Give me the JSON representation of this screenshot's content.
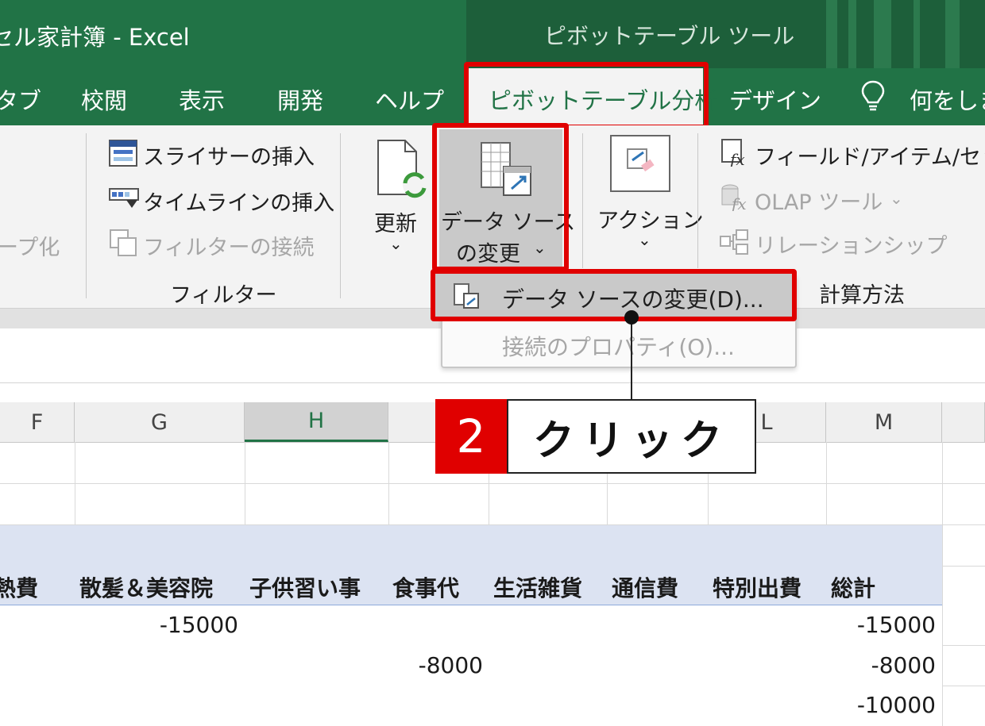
{
  "window": {
    "title": "セル家計簿 - Excel",
    "context_tools": "ピボットテーブル ツール"
  },
  "tabs": {
    "items": [
      "タブ",
      "校閲",
      "表示",
      "開発",
      "ヘルプ"
    ],
    "active": "ピボットテーブル分析",
    "design": "デザイン",
    "tell_me": "何をしま"
  },
  "ribbon": {
    "group_label_partial": "ープ化",
    "slicer_insert": "スライサーの挿入",
    "timeline_insert": "タイムラインの挿入",
    "filter_connect": "フィルターの接続",
    "filter_group": "フィルター",
    "refresh": "更新",
    "change_source_l1": "データ ソース",
    "change_source_l2": "の変更",
    "action": "アクション",
    "field_items": "フィールド/アイテム/セット",
    "olap_tools": "OLAP ツール",
    "relationships": "リレーションシップ",
    "calc_group": "計算方法",
    "dropdown_arrow": "⌄"
  },
  "dropdown": {
    "item_change_source": "データ ソースの変更(D)...",
    "item_conn_props": "接続のプロパティ(O)..."
  },
  "callout": {
    "step": "2",
    "text": "クリック"
  },
  "columns": [
    "F",
    "G",
    "H",
    "L",
    "M"
  ],
  "pivot": {
    "headers": [
      "熱費",
      "散髪＆美容院",
      "子供習い事",
      "食事代",
      "生活雑貨",
      "通信費",
      "特別出費",
      "総計"
    ],
    "rows": [
      {
        "g": "-15000",
        "total": "-15000"
      },
      {
        "food": "-8000",
        "total": "-8000"
      },
      {
        "total": "-10000"
      }
    ]
  },
  "colors": {
    "excel_green": "#217346",
    "highlight_red": "#e00000",
    "pivot_header": "#dce3f2"
  }
}
